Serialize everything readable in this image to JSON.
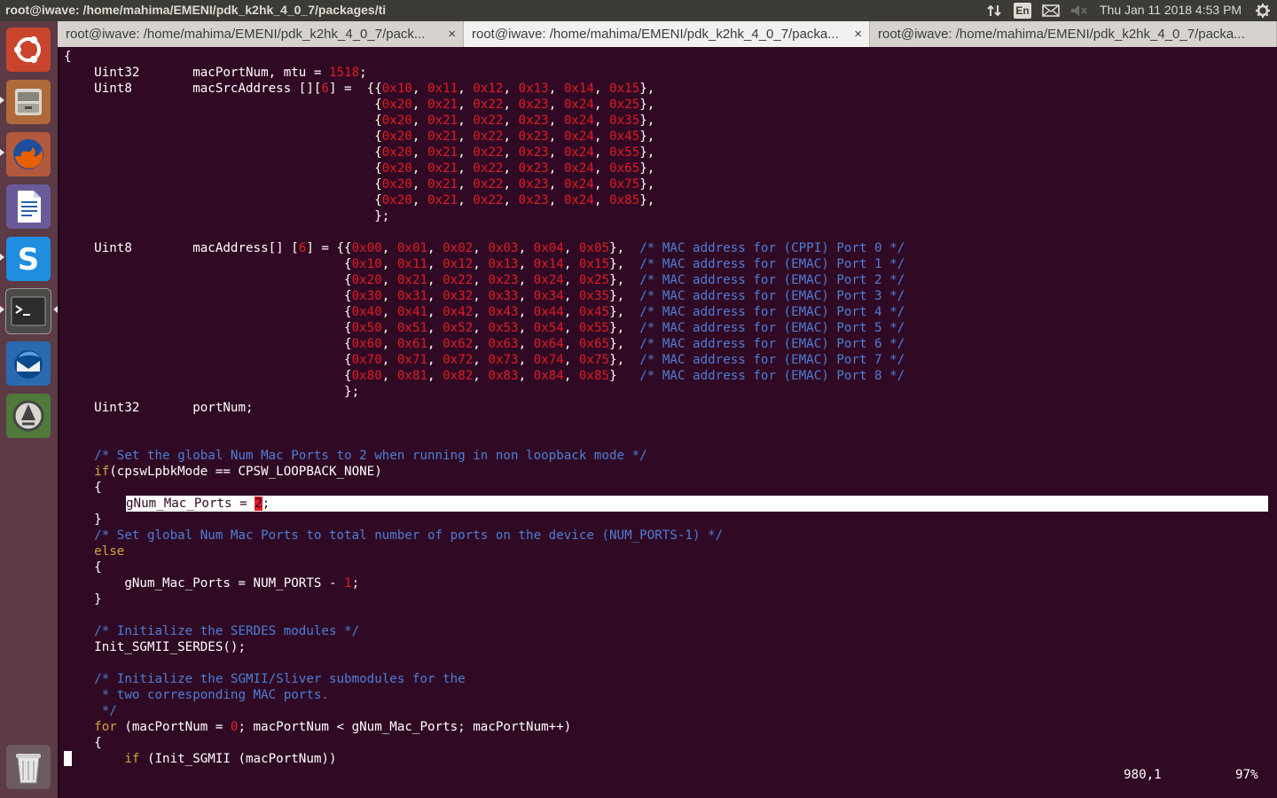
{
  "topbar": {
    "title": "root@iwave: /home/mahima/EMENI/pdk_k2hk_4_0_7/packages/ti",
    "keyboard_layout": "En",
    "datetime": "Thu Jan 11 2018  4:53 PM",
    "icons": [
      "network-transfer-icon",
      "keyboard-layout-icon",
      "mail-icon",
      "volume-muted-icon",
      "settings-gear-icon"
    ]
  },
  "launcher": {
    "items": [
      "ubuntu-dash",
      "files",
      "firefox",
      "libreoffice-writer",
      "skype",
      "terminal",
      "thunderbird",
      "software-updater",
      "trash"
    ]
  },
  "tabs": [
    {
      "label": "root@iwave: /home/mahima/EMENI/pdk_k2hk_4_0_7/pack...",
      "close": "×",
      "active": false
    },
    {
      "label": "root@iwave: /home/mahima/EMENI/pdk_k2hk_4_0_7/packa...",
      "close": "×",
      "active": true
    },
    {
      "label": "root@iwave: /home/mahima/EMENI/pdk_k2hk_4_0_7/packa...",
      "close": "×",
      "active": false
    }
  ],
  "editor": {
    "lines": {
      "l00": "{",
      "l01a": "    Uint32       macPortNum, mtu = ",
      "l01n": "1518",
      "l01b": ";",
      "l02": "    Uint8        macSrcAddress [][6] =  {{0x10, 0x11, 0x12, 0x13, 0x14, 0x15},",
      "l03": "                                         {0x20, 0x21, 0x22, 0x23, 0x24, 0x25},",
      "l04": "                                         {0x20, 0x21, 0x22, 0x23, 0x24, 0x35},",
      "l05": "                                         {0x20, 0x21, 0x22, 0x23, 0x24, 0x45},",
      "l06": "                                         {0x20, 0x21, 0x22, 0x23, 0x24, 0x55},",
      "l07": "                                         {0x20, 0x21, 0x22, 0x23, 0x24, 0x65},",
      "l08": "                                         {0x20, 0x21, 0x22, 0x23, 0x24, 0x75},",
      "l09": "                                         {0x20, 0x21, 0x22, 0x23, 0x24, 0x85},",
      "l10": "                                         };",
      "l12": "    Uint8        macAddress[] [6] = {{0x00, 0x01, 0x02, 0x03, 0x04, 0x05},  /* MAC address for (CPPI) Port 0 */",
      "l13": "                                     {0x10, 0x11, 0x12, 0x13, 0x14, 0x15},  /* MAC address for (EMAC) Port 1 */",
      "l14": "                                     {0x20, 0x21, 0x22, 0x23, 0x24, 0x25},  /* MAC address for (EMAC) Port 2 */",
      "l15": "                                     {0x30, 0x31, 0x32, 0x33, 0x34, 0x35},  /* MAC address for (EMAC) Port 3 */",
      "l16": "                                     {0x40, 0x41, 0x42, 0x43, 0x44, 0x45},  /* MAC address for (EMAC) Port 4 */",
      "l17": "                                     {0x50, 0x51, 0x52, 0x53, 0x54, 0x55},  /* MAC address for (EMAC) Port 5 */",
      "l18": "                                     {0x60, 0x61, 0x62, 0x63, 0x64, 0x65},  /* MAC address for (EMAC) Port 6 */",
      "l19": "                                     {0x70, 0x71, 0x72, 0x73, 0x74, 0x75},  /* MAC address for (EMAC) Port 7 */",
      "l20": "                                     {0x80, 0x81, 0x82, 0x83, 0x84, 0x85}   /* MAC address for (EMAC) Port 8 */",
      "l21": "                                     };",
      "l22": "    Uint32       portNum;",
      "l25": "    /* Set the global Num Mac Ports to 2 when running in non loopback mode */",
      "l26k": "    if",
      "l26": "(cpswLpbkMode == CPSW_LOOPBACK_NONE)",
      "l27": "    {",
      "l28a": "gNum_Mac_Ports = ",
      "l28n": "2",
      "l28b": ";",
      "l29": "    }",
      "l30": "    /* Set global Num Mac Ports to total number of ports on the device (NUM_PORTS-1) */",
      "l31": "    else",
      "l32": "    {",
      "l33a": "        gNum_Mac_Ports = NUM_PORTS - ",
      "l33n": "1",
      "l33b": ";",
      "l34": "    }",
      "l36": "    /* Initialize the SERDES modules */",
      "l37": "    Init_SGMII_SERDES();",
      "l39": "    /* Initialize the SGMII/Sliver submodules for the",
      "l40": "     * two corresponding MAC ports.",
      "l41": "     */",
      "l42k": "    for",
      "l42a": " (macPortNum = ",
      "l42n": "0",
      "l42b": "; macPortNum < gNum_Mac_Ports; macPortNum++)",
      "l43": "    {",
      "l44k": "        if",
      "l44": " (Init_SGMII (macPortNum))"
    },
    "status_position": "980,1",
    "status_percent": "97%"
  }
}
